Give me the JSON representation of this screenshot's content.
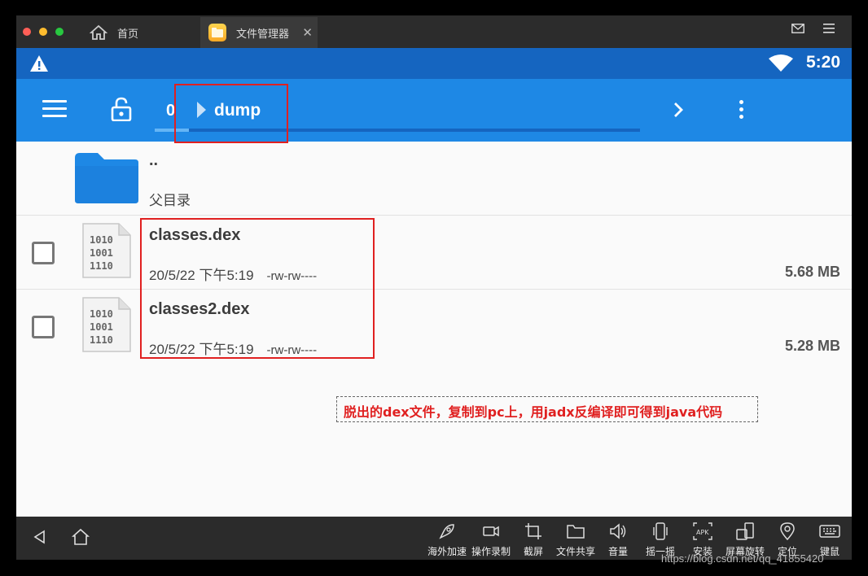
{
  "titlebar": {
    "tabs": [
      {
        "label": "首页",
        "icon": "home-icon"
      },
      {
        "label": "文件管理器",
        "icon": "file-manager-app-icon"
      }
    ],
    "close_glyph": "✕",
    "mail_icon": "mail-icon",
    "menu_icon": "hamburger-icon"
  },
  "statusbar": {
    "time": "5:20",
    "icons": [
      "warning-icon",
      "wifi-icon"
    ]
  },
  "appbar": {
    "breadcrumb": [
      "0",
      "dump"
    ],
    "scroll_progress": 0.07,
    "icons": [
      "menu-icon",
      "lock-open-icon",
      "chevron-right-icon",
      "more-vert-icon"
    ]
  },
  "parent_row": {
    "name": "..",
    "label": "父目录"
  },
  "files": [
    {
      "name": "classes.dex",
      "date": "20/5/22 下午5:19",
      "perm": "-rw-rw----",
      "size": "5.68 MB"
    },
    {
      "name": "classes2.dex",
      "date": "20/5/22 下午5:19",
      "perm": "-rw-rw----",
      "size": "5.28 MB"
    }
  ],
  "annotation": {
    "note": "脱出的dex文件，复制到pc上，用jadx反编译即可得到java代码",
    "color": "#e02020"
  },
  "bottombar": {
    "tools": [
      "海外加速",
      "操作录制",
      "截屏",
      "文件共享",
      "音量",
      "摇一摇",
      "安装",
      "屏幕旋转",
      "定位",
      "键鼠"
    ]
  },
  "watermark": "https://blog.csdn.net/qq_41855420",
  "colors": {
    "statusbar": "#1565c0",
    "appbar": "#1e88e5",
    "folder": "#1e88e5"
  }
}
